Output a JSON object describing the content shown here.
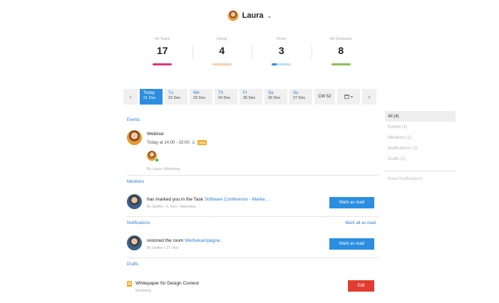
{
  "user": {
    "name": "Laura"
  },
  "stats": [
    {
      "label": "All Tasks",
      "value": "17",
      "color": "#e0357a"
    },
    {
      "label": "Doing",
      "value": "4",
      "color": "#f9cfb2"
    },
    {
      "label": "Done",
      "value": "3",
      "colors": [
        "#2b8ee0",
        "#bfe0f7"
      ]
    },
    {
      "label": "All Subtasks",
      "value": "8",
      "color": "#8cc152"
    }
  ],
  "dates": [
    {
      "day": "Today",
      "date": "21 Dec"
    },
    {
      "day": "Tu",
      "date": "22 Dec"
    },
    {
      "day": "We",
      "date": "23 Dec"
    },
    {
      "day": "Th",
      "date": "24 Dec"
    },
    {
      "day": "Fr",
      "date": "25 Dec"
    },
    {
      "day": "Sa",
      "date": "26 Dec"
    },
    {
      "day": "Su",
      "date": "27 Dec"
    }
  ],
  "week": "CW 52",
  "events": {
    "title": "Events",
    "item": {
      "title": "Webinar",
      "time": "Today at 14:00 - 15:00",
      "badge": "NEW",
      "by": "By Laura • Marketing"
    }
  },
  "mentions": {
    "title": "Mentions",
    "item": {
      "text": "has marked you in the Task ",
      "link": "Software Conference - Marke....",
      "by": "By Steffen • 6. Nov • Marketing",
      "button": "Mark as read"
    }
  },
  "notifications": {
    "title": "Notifications",
    "mark_all": "Mark all as read",
    "item": {
      "text": "restored the room ",
      "link": "Werbekampagne",
      "suffix": ".",
      "by": "By Steffen • 27. Nov",
      "button": "Mark as read"
    }
  },
  "drafts": {
    "title": "Drafts",
    "item": {
      "title": "Whitepaper für Design Contest",
      "sub": "Marketing",
      "button": "Edit"
    }
  },
  "filters": [
    "All (4)",
    "Events (1)",
    "Mentions (1)",
    "Notifications (1)",
    "Drafts (1)"
  ],
  "read_notifications": "Read Notifications"
}
